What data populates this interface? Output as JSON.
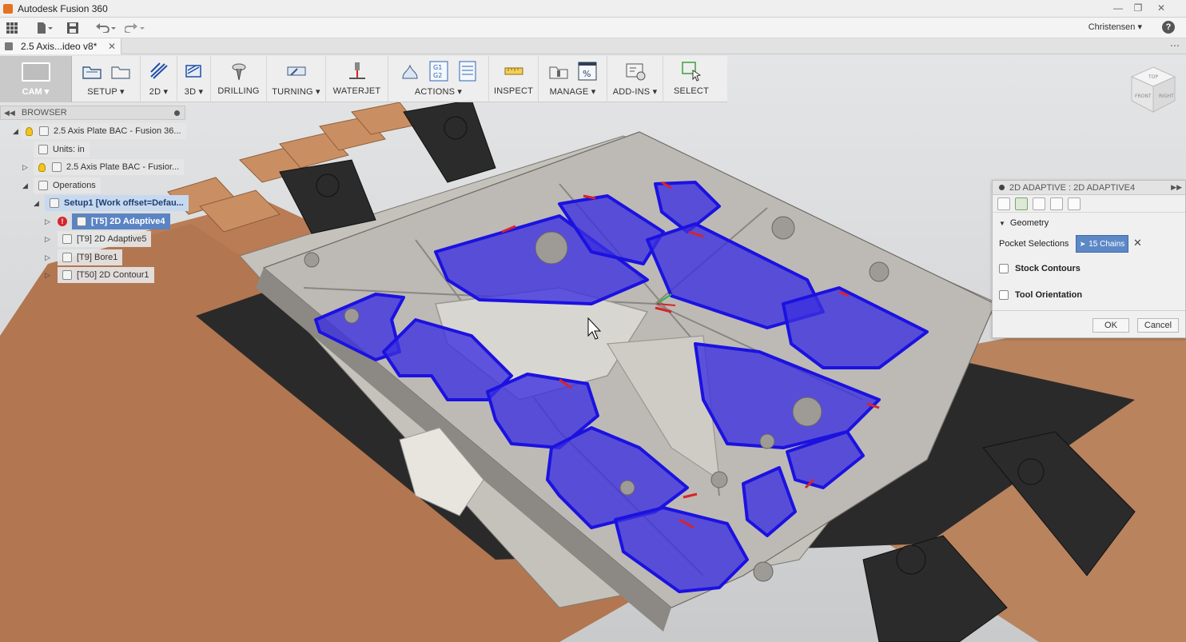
{
  "window": {
    "title": "Autodesk Fusion 360",
    "controls": [
      "minimize",
      "restore",
      "close"
    ]
  },
  "quick_access": {
    "user_name": "Christensen",
    "help_symbol": "?"
  },
  "document_tab": {
    "label": "2.5 Axis...ideo v8*",
    "close_symbol": "✕"
  },
  "ribbon": {
    "workspace_label": "CAM",
    "groups": [
      {
        "key": "setup",
        "label": "SETUP"
      },
      {
        "key": "2d",
        "label": "2D"
      },
      {
        "key": "3d",
        "label": "3D"
      },
      {
        "key": "drilling",
        "label": "DRILLING"
      },
      {
        "key": "turning",
        "label": "TURNING"
      },
      {
        "key": "waterjet",
        "label": "WATERJET"
      },
      {
        "key": "actions",
        "label": "ACTIONS"
      },
      {
        "key": "inspect",
        "label": "INSPECT"
      },
      {
        "key": "manage",
        "label": "MANAGE"
      },
      {
        "key": "addins",
        "label": "ADD-INS"
      },
      {
        "key": "select",
        "label": "SELECT"
      }
    ],
    "actions_g1": "G1",
    "actions_g2": "G2",
    "manage_percent": "%"
  },
  "browser": {
    "title": "BROWSER",
    "root": "2.5 Axis Plate BAC - Fusion 36...",
    "units": "Units: in",
    "component": "2.5 Axis Plate BAC - Fusior...",
    "operations": "Operations",
    "setup": "Setup1 [Work offset=Defau...",
    "items": [
      {
        "label": "[T5] 2D Adaptive4",
        "selected": true,
        "error": true
      },
      {
        "label": "[T9] 2D Adaptive5",
        "selected": false,
        "error": false
      },
      {
        "label": "[T9] Bore1",
        "selected": false,
        "error": false
      },
      {
        "label": "[T50] 2D Contour1",
        "selected": false,
        "error": false
      }
    ],
    "error_symbol": "!"
  },
  "dialog": {
    "title": "2D ADAPTIVE : 2D ADAPTIVE4",
    "section": "Geometry",
    "pocket_label": "Pocket Selections",
    "chains_value": "15 Chains",
    "clear_symbol": "✕",
    "stock_contours": "Stock Contours",
    "tool_orientation": "Tool Orientation",
    "stock_contours_checked": false,
    "tool_orientation_checked": false,
    "ok": "OK",
    "cancel": "Cancel"
  },
  "viewcube_faces": [
    "TOP",
    "FRONT",
    "RIGHT"
  ],
  "colors": {
    "toolpath": "#1b12e0",
    "pocket_fill": "#3b2ee0",
    "plate": "#bdbab5",
    "wood": "#c98f62",
    "clamp": "#2b2b2b",
    "selection": "#5b84c4"
  }
}
